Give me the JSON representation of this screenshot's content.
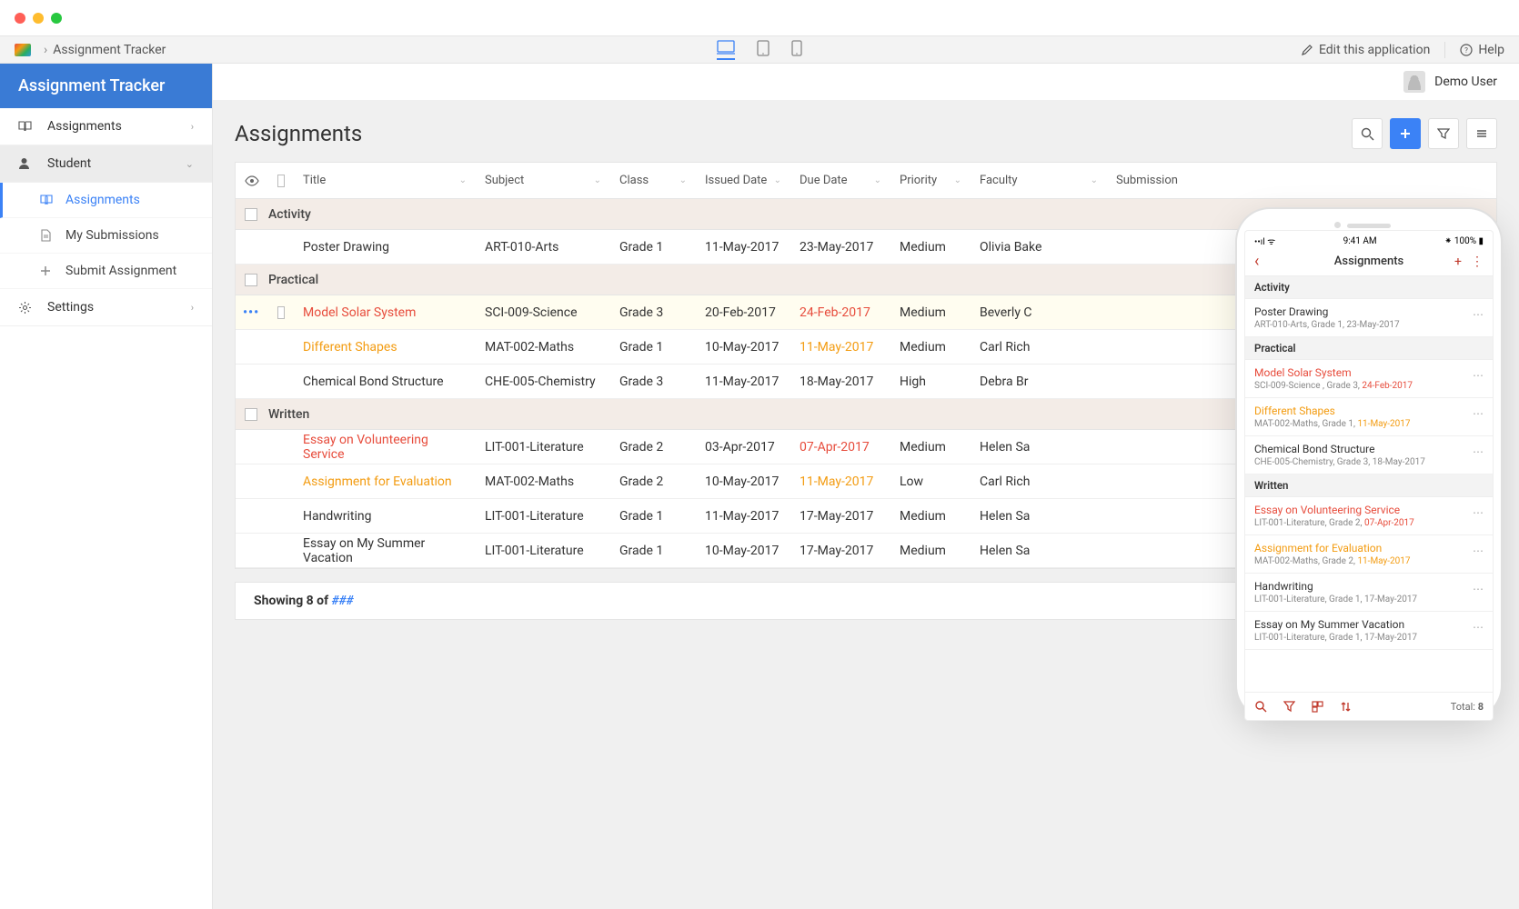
{
  "breadcrumb": {
    "app": "Assignment Tracker"
  },
  "topbar": {
    "edit": "Edit this application",
    "help": "Help"
  },
  "sidebar": {
    "title": "Assignment Tracker",
    "items": [
      {
        "label": "Assignments"
      },
      {
        "label": "Student"
      },
      {
        "label": "Settings"
      }
    ],
    "student_sub": [
      {
        "label": "Assignments"
      },
      {
        "label": "My Submissions"
      },
      {
        "label": "Submit Assignment"
      }
    ]
  },
  "user": {
    "name": "Demo User"
  },
  "page": {
    "title": "Assignments"
  },
  "columns": {
    "title": "Title",
    "subject": "Subject",
    "class": "Class",
    "issued": "Issued Date",
    "due": "Due Date",
    "priority": "Priority",
    "faculty": "Faculty",
    "submission": "Submission"
  },
  "groups": {
    "activity": "Activity",
    "practical": "Practical",
    "written": "Written"
  },
  "rows": {
    "r0": {
      "title": "Poster Drawing",
      "subject": "ART-010-Arts",
      "class": "Grade 1",
      "issued": "11-May-2017",
      "due": "23-May-2017",
      "priority": "Medium",
      "faculty": "Olivia Bake"
    },
    "r1": {
      "title": "Model Solar System",
      "subject": "SCI-009-Science",
      "class": "Grade 3",
      "issued": "20-Feb-2017",
      "due": "24-Feb-2017",
      "priority": "Medium",
      "faculty": "Beverly C"
    },
    "r2": {
      "title": "Different Shapes",
      "subject": "MAT-002-Maths",
      "class": "Grade 1",
      "issued": "10-May-2017",
      "due": "11-May-2017",
      "priority": "Medium",
      "faculty": "Carl Rich"
    },
    "r3": {
      "title": "Chemical Bond Structure",
      "subject": "CHE-005-Chemistry",
      "class": "Grade 3",
      "issued": "11-May-2017",
      "due": "18-May-2017",
      "priority": "High",
      "faculty": "Debra Br"
    },
    "r4": {
      "title": "Essay on Volunteering Service",
      "subject": "LIT-001-Literature",
      "class": "Grade 2",
      "issued": "03-Apr-2017",
      "due": "07-Apr-2017",
      "priority": "Medium",
      "faculty": "Helen Sa"
    },
    "r5": {
      "title": "Assignment for Evaluation",
      "subject": "MAT-002-Maths",
      "class": "Grade 2",
      "issued": "10-May-2017",
      "due": "11-May-2017",
      "priority": "Low",
      "faculty": "Carl Rich"
    },
    "r6": {
      "title": "Handwriting",
      "subject": "LIT-001-Literature",
      "class": "Grade 1",
      "issued": "11-May-2017",
      "due": "17-May-2017",
      "priority": "Medium",
      "faculty": "Helen Sa"
    },
    "r7": {
      "title": "Essay on My Summer Vacation",
      "subject": "LIT-001-Literature",
      "class": "Grade 1",
      "issued": "10-May-2017",
      "due": "17-May-2017",
      "priority": "Medium",
      "faculty": "Helen Sa"
    }
  },
  "footer": {
    "showing": "Showing 8 of ",
    "hash": "###"
  },
  "phone": {
    "status": {
      "time": "9:41 AM",
      "battery": "100%"
    },
    "title": "Assignments",
    "sections": {
      "activity": "Activity",
      "practical": "Practical",
      "written": "Written"
    },
    "items": {
      "p0": {
        "title": "Poster Drawing",
        "sub": "ART-010-Arts, Grade 1, 23-May-2017"
      },
      "p1": {
        "title": "Model Solar System",
        "sub1": "SCI-009-Science , Grade 3, ",
        "date": "24-Feb-2017"
      },
      "p2": {
        "title": "Different Shapes",
        "sub1": "MAT-002-Maths, Grade 1, ",
        "date": "11-May-2017"
      },
      "p3": {
        "title": "Chemical Bond Structure",
        "sub": "CHE-005-Chemistry, Grade 3, 18-May-2017"
      },
      "p4": {
        "title": "Essay on Volunteering Service",
        "sub1": "LIT-001-Literature, Grade 2, ",
        "date": "07-Apr-2017"
      },
      "p5": {
        "title": "Assignment for Evaluation",
        "sub1": "MAT-002-Maths, Grade 2, ",
        "date": "11-May-2017"
      },
      "p6": {
        "title": "Handwriting",
        "sub": "LIT-001-Literature, Grade 1, 17-May-2017"
      },
      "p7": {
        "title": "Essay on My Summer Vacation",
        "sub": "LIT-001-Literature, Grade 1, 17-May-2017"
      }
    },
    "total_label": "Total: ",
    "total": "8"
  }
}
